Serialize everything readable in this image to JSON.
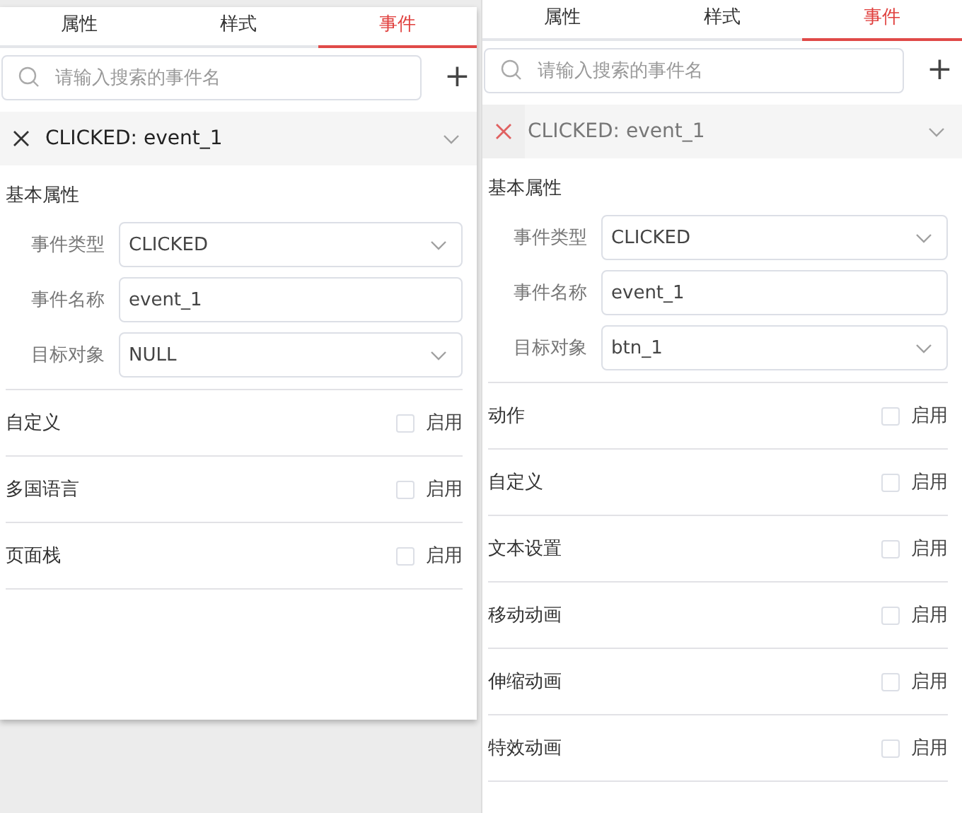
{
  "panels": [
    {
      "tabs": [
        {
          "label": "属性",
          "selected": false
        },
        {
          "label": "样式",
          "selected": false
        },
        {
          "label": "事件",
          "selected": true
        }
      ],
      "search": {
        "placeholder": "请输入搜索的事件名"
      },
      "add_button": "+",
      "event": {
        "title": "CLICKED: event_1",
        "hovered": false
      },
      "section_title": "基本属性",
      "fields": [
        {
          "label": "事件类型",
          "value": "CLICKED",
          "kind": "select"
        },
        {
          "label": "事件名称",
          "value": "event_1",
          "kind": "text"
        },
        {
          "label": "目标对象",
          "value": "NULL",
          "kind": "select"
        }
      ],
      "options": [
        {
          "label": "自定义",
          "checked": false,
          "enable_label": "启用"
        },
        {
          "label": "多国语言",
          "checked": false,
          "enable_label": "启用"
        },
        {
          "label": "页面栈",
          "checked": false,
          "enable_label": "启用"
        }
      ]
    },
    {
      "tabs": [
        {
          "label": "属性",
          "selected": false
        },
        {
          "label": "样式",
          "selected": false
        },
        {
          "label": "事件",
          "selected": true
        }
      ],
      "search": {
        "placeholder": "请输入搜索的事件名"
      },
      "add_button": "+",
      "event": {
        "title": "CLICKED: event_1",
        "hovered": true
      },
      "section_title": "基本属性",
      "fields": [
        {
          "label": "事件类型",
          "value": "CLICKED",
          "kind": "select"
        },
        {
          "label": "事件名称",
          "value": "event_1",
          "kind": "text"
        },
        {
          "label": "目标对象",
          "value": "btn_1",
          "kind": "select"
        }
      ],
      "options": [
        {
          "label": "动作",
          "checked": false,
          "enable_label": "启用"
        },
        {
          "label": "自定义",
          "checked": false,
          "enable_label": "启用"
        },
        {
          "label": "文本设置",
          "checked": false,
          "enable_label": "启用"
        },
        {
          "label": "移动动画",
          "checked": false,
          "enable_label": "启用"
        },
        {
          "label": "伸缩动画",
          "checked": false,
          "enable_label": "启用"
        },
        {
          "label": "特效动画",
          "checked": false,
          "enable_label": "启用"
        }
      ]
    }
  ]
}
